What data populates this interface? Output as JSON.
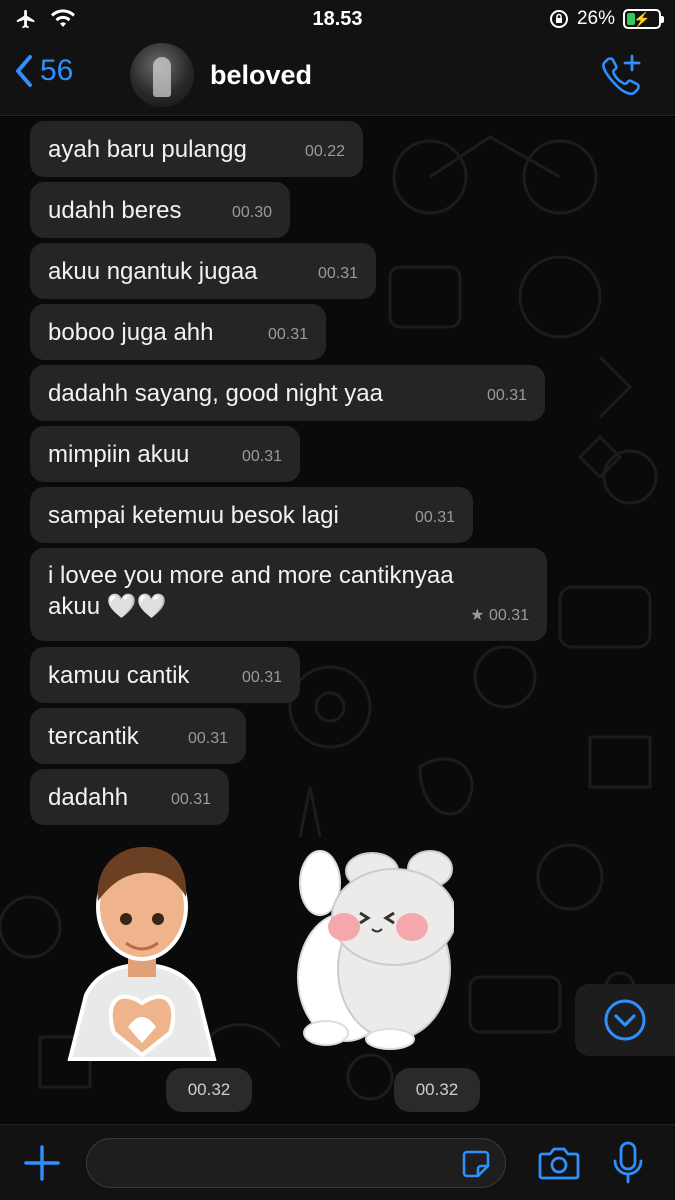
{
  "status_bar": {
    "time": "18.53",
    "battery": "26%",
    "battery_level": 0.26
  },
  "header": {
    "back_count": "56",
    "title": "beloved"
  },
  "messages": [
    {
      "text": "ayah baru pulangg",
      "time": "00.22"
    },
    {
      "text": "udahh beres",
      "time": "00.30"
    },
    {
      "text": "akuu ngantuk jugaa",
      "time": "00.31"
    },
    {
      "text": "boboo juga ahh",
      "time": "00.31"
    },
    {
      "text": "dadahh sayang, good night yaa",
      "time": "00.31"
    },
    {
      "text": "mimpiin akuu",
      "time": "00.31"
    },
    {
      "text": "sampai ketemuu besok lagi",
      "time": "00.31"
    },
    {
      "text": "i lovee you more and more cantiknyaa akuu 🤍🤍",
      "time": "★ 00.31",
      "starred": true
    },
    {
      "text": "kamuu cantik",
      "time": "00.31"
    },
    {
      "text": "tercantik",
      "time": "00.31"
    },
    {
      "text": "dadahh",
      "time": "00.31"
    }
  ],
  "stickers": [
    {
      "icon": "memoji-heart-hands-sticker",
      "time": "00.32"
    },
    {
      "icon": "bunny-hug-sticker",
      "time": "00.32"
    }
  ],
  "colors": {
    "accent": "#2e90ff",
    "bubble": "#252525",
    "background": "#0a0a0a"
  }
}
